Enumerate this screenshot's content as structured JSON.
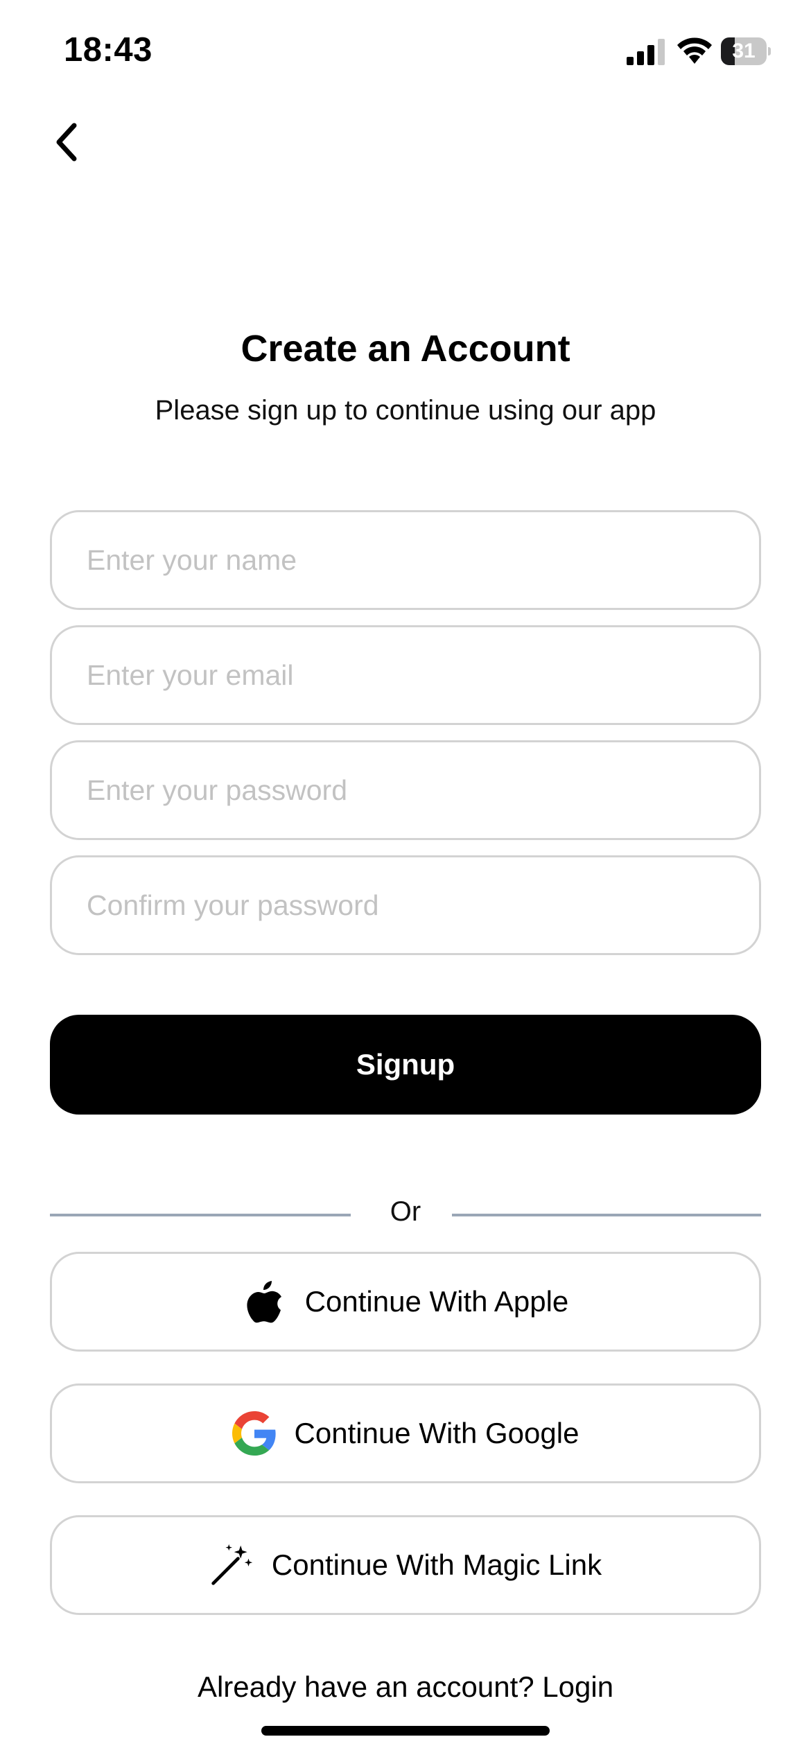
{
  "status_bar": {
    "time": "18:43",
    "battery_level": "31",
    "battery_fraction": 0.31,
    "icons": [
      "signal-icon",
      "wifi-icon",
      "battery-icon"
    ]
  },
  "back": {
    "icon": "chevron-left-icon"
  },
  "header": {
    "title": "Create an Account",
    "subtitle": "Please sign up to continue using our app"
  },
  "form": {
    "name": {
      "placeholder": "Enter your name",
      "value": ""
    },
    "email": {
      "placeholder": "Enter your email",
      "value": ""
    },
    "password": {
      "placeholder": "Enter your password",
      "value": ""
    },
    "confirm_password": {
      "placeholder": "Confirm your password",
      "value": ""
    },
    "submit_label": "Signup"
  },
  "divider": {
    "label": "Or"
  },
  "social": {
    "apple": {
      "label": "Continue With Apple",
      "icon": "apple-icon"
    },
    "google": {
      "label": "Continue With Google",
      "icon": "google-icon"
    },
    "magic_link": {
      "label": "Continue With Magic Link",
      "icon": "magic-wand-icon"
    }
  },
  "footer": {
    "prompt": "Already have an account?",
    "login_label": "Login"
  },
  "colors": {
    "primary": "#000000",
    "border": "#d3d3d3",
    "placeholder": "#c2c2c2",
    "divider": "#9aa6b6",
    "google_blue": "#4285F4",
    "google_red": "#EA4335",
    "google_yellow": "#FBBC05",
    "google_green": "#34A853"
  }
}
